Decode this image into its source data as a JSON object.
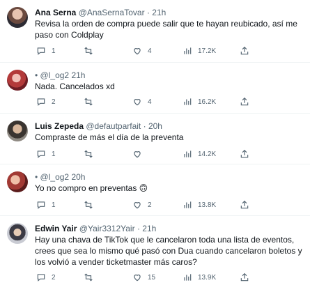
{
  "tweets": [
    {
      "name": "Ana Serna",
      "handle": "@AnaSernaTovar",
      "time": "21h",
      "text": "Revisa la orden de compra puede salir que te hayan reubicado, así me paso con Coldplay",
      "replies": "1",
      "retweets": "",
      "likes": "4",
      "views": "17.2K"
    },
    {
      "name": "",
      "handle": "@l_og2",
      "time": "21h",
      "text": "Nada. Cancelados xd",
      "replies": "2",
      "retweets": "",
      "likes": "4",
      "views": "16.2K"
    },
    {
      "name": "Luis Zepeda",
      "handle": "@defautparfait",
      "time": "20h",
      "text": "Compraste de más el día de la preventa",
      "replies": "1",
      "retweets": "",
      "likes": "",
      "views": "14.2K"
    },
    {
      "name": "",
      "handle": "@l_og2",
      "time": "20h",
      "text": "Yo no compro en preventas 🙃",
      "replies": "1",
      "retweets": "",
      "likes": "2",
      "views": "13.8K"
    },
    {
      "name": "Edwin Yair",
      "handle": "@Yair3312Yair",
      "time": "21h",
      "text": "Hay una chava de TikTok que le cancelaron toda una lista de eventos, crees que sea lo mismo qué pasó con Dua cuando cancelaron boletos y los volvió a vender ticketmaster más caros?",
      "replies": "2",
      "retweets": "",
      "likes": "15",
      "views": "13.9K"
    }
  ],
  "labels": {
    "separator": "·",
    "dot_prefix": "•"
  },
  "colors": {
    "muted": "#536471",
    "text": "#0f1419",
    "divider": "#eff3f4"
  },
  "icons": {
    "reply": "reply-icon",
    "retweet": "retweet-icon",
    "like": "heart-icon",
    "views": "views-icon",
    "share": "share-icon"
  }
}
